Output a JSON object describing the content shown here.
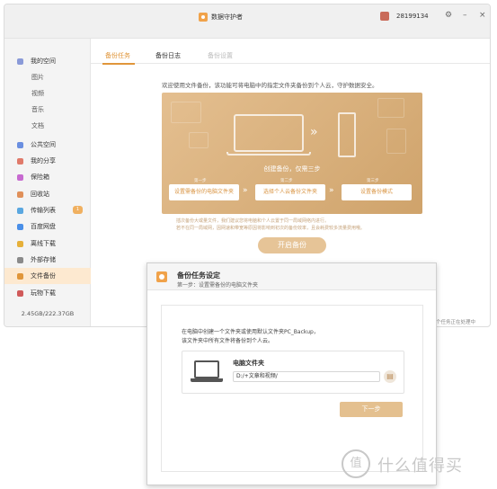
{
  "window": {
    "app_title": "数据守护者",
    "user_id": "28199134"
  },
  "sidebar": {
    "items": [
      {
        "label": "我的空间"
      },
      {
        "label": "图片"
      },
      {
        "label": "视频"
      },
      {
        "label": "音乐"
      },
      {
        "label": "文档"
      },
      {
        "label": "公共空间"
      },
      {
        "label": "我的分享"
      },
      {
        "label": "保险箱"
      },
      {
        "label": "回收站"
      },
      {
        "label": "传输列表",
        "badge": "1"
      },
      {
        "label": "百度网盘"
      },
      {
        "label": "离线下载"
      },
      {
        "label": "外部存储"
      },
      {
        "label": "文件备份"
      },
      {
        "label": "玩物下载"
      }
    ],
    "storage": "2.45GB/222.37GB"
  },
  "tabs": [
    {
      "label": "备份任务"
    },
    {
      "label": "备份日志"
    },
    {
      "label": "备份设置"
    }
  ],
  "backup": {
    "intro": "欢迎使用文件备份，该功能可将电脑中的指定文件夹备份到个人云，守护数据安全。",
    "banner_title": "创建备份，仅需三步",
    "steps": [
      {
        "num": "第一步",
        "label": "设置需备份的电脑文件夹"
      },
      {
        "num": "第二步",
        "label": "选择个人云备份文件夹"
      },
      {
        "num": "第三步",
        "label": "设置备份模式"
      }
    ],
    "note1": "插次备份大或量文件，我们建议您将电脑和个人云置于同一局域网络内进行。",
    "note2": "若不在同一局域网，因网速和带宽等原因将影响到初次的备份效率，且会耗费较多流量费用哦。",
    "start_button": "开启备份"
  },
  "status_text": "个任务正在处理中",
  "dialog": {
    "title": "备份任务设定",
    "subtitle": "第一步：设置需备份的电脑文件夹",
    "desc1": "在电脑中创建一个文件夹或使用默认文件夹PC_Backup，",
    "desc2": "该文件夹中所有文件将备份到个人云。",
    "folder_title": "电脑文件夹",
    "path": "D:/+文章和视频/",
    "next_button": "下一步"
  },
  "watermark": {
    "logo": "值",
    "text": "什么值得买"
  },
  "colors": {
    "accent": "#e0963a",
    "banner": "#dcb27f",
    "sidebar_active": "#fde9d0"
  }
}
